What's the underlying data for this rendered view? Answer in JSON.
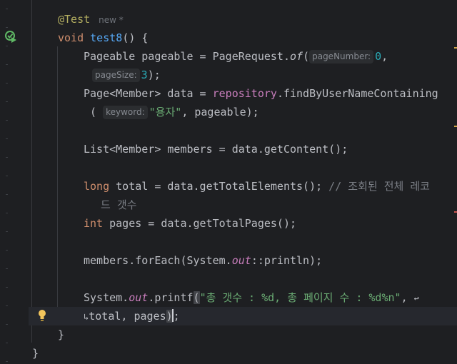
{
  "gutter": {
    "run_icon": "run-test-passed-icon",
    "bulb_icon": "lightbulb-icon"
  },
  "colors": {
    "background": "#1e1f22",
    "current_line": "#26282e",
    "keyword": "#cf8e6d",
    "method": "#56a8f5",
    "string": "#6aab73",
    "number": "#2aacb8",
    "comment": "#7a7e85",
    "annotation": "#b3ae60",
    "static_field": "#c77dbb",
    "warning_marker": "#d0a448",
    "error_marker": "#c75450"
  },
  "code": {
    "l1": {
      "annotation": "@Test",
      "new_tag": "new *"
    },
    "l2": {
      "kw": "void",
      "name": "test8",
      "rest": "() {"
    },
    "l3": {
      "type": "Pageable",
      "var": " pageable = PageRequest.",
      "call": "of",
      "open": "(",
      "hint1": "pageNumber:",
      "num1": "0",
      "comma": ","
    },
    "l4": {
      "hint2": "pageSize:",
      "num2": "3",
      "close": ");"
    },
    "l5": {
      "type": "Page<Member> data = ",
      "field": "repository",
      "call": ".findByUserNameContaining"
    },
    "l6": {
      "open": " (",
      "hint3": "keyword:",
      "str": "\"용자\"",
      "rest": ", pageable);"
    },
    "l7": {
      "text": "List<Member> members = data.getContent();"
    },
    "l8": {
      "kw": "long",
      "rest": " total = data.getTotalElements(); ",
      "comment": "// 조회된 전체 레코"
    },
    "l9": {
      "comment": "드 갯수"
    },
    "l10": {
      "kw": "int",
      "rest": " pages = data.getTotalPages();"
    },
    "l11": {
      "a": "members.forEach(System.",
      "out": "out",
      "b": "::println);"
    },
    "l12": {
      "a": "System.",
      "out": "out",
      "b": ".printf",
      "paren": "(",
      "str": "\"총 갯수 : %d, 총 페이지 수 : %d%n\"",
      "c": ", "
    },
    "l13": {
      "a": "total, pages",
      "paren": ")",
      "end": ";"
    },
    "l14": {
      "text": "}"
    },
    "l15": {
      "text": "}"
    }
  }
}
